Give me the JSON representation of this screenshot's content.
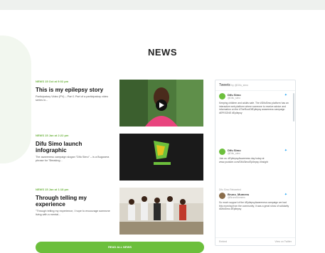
{
  "section": {
    "title": "NEWS"
  },
  "news": [
    {
      "meta": "NEWS   15 Oct at 9:02 pm",
      "headline": "This is my epilepsy story",
      "excerpt": "Participatory Video (PV) – Part 1 Part of a participatory video series in..."
    },
    {
      "meta": "NEWS   15 Jan at 2:22 pm",
      "headline": "Difu Simo launch infographic",
      "excerpt": "The awareness campaign slogan \"Difu Simo\" – is a Bugusera phrase for \"Breaking..."
    },
    {
      "meta": "NEWS   15 Jan at 1:18 pm",
      "headline": "Through telling my experience",
      "excerpt": "\"Through telling my experience, I hope to encourage someone living with a mental..."
    }
  ],
  "button": {
    "label": "READ ALL NEWS"
  },
  "twitter": {
    "title": "Tweets",
    "by": "by @Difu_simo",
    "tweets": [
      {
        "name": "Difu Simo",
        "handle": "@Difu_simo",
        "text": "Keeping children and adults safe. The #DifuSimo platform has an interactive web platform where someone to receive advice and information on the #TheRootOfEpilepsy awareness campaign #EPISONE #Epilepsy"
      },
      {
        "name": "Difu Simo",
        "handle": "@Difu_simo",
        "text": "Join us: #EpilepsyAwareness day today at www.youtube.com/DifuSimo/Epilepsy #Insight"
      },
      {
        "name": "Bruno_Mumens",
        "handle": "@BrunoMumens",
        "retweet": "Difu Simo Retweeted",
        "text": "So much support of the #EpilepsyAwareness campaign we had this morning from the community; it was a great show of solidarity #DifuSimo #Epilepsy"
      }
    ],
    "footer_left": "Embed",
    "footer_right": "View on Twitter"
  },
  "colors": {
    "accent": "#6cbf3c",
    "twitter": "#1da1f2"
  }
}
